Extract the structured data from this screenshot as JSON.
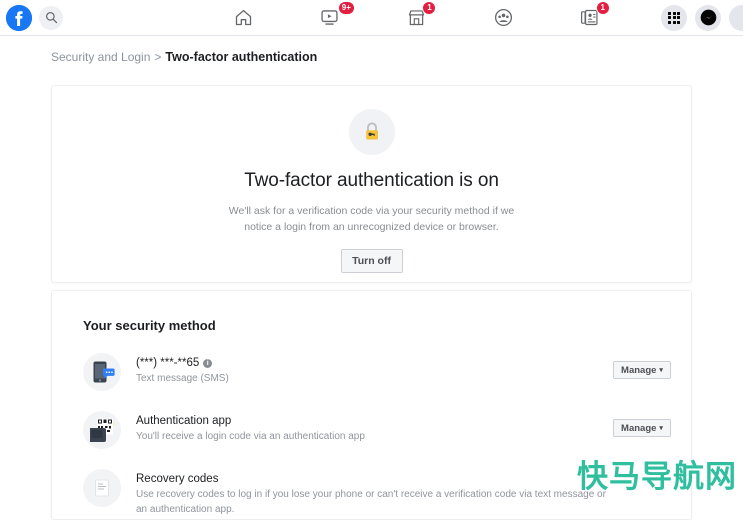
{
  "nav": {
    "logo_icon": "facebook-logo-icon",
    "search_icon": "search-icon",
    "tabs": [
      {
        "icon": "home-icon",
        "name": "home",
        "badge": ""
      },
      {
        "icon": "watch-video-icon",
        "name": "watch",
        "badge": "9+"
      },
      {
        "icon": "marketplace-storefront-icon",
        "name": "marketplace",
        "badge": "1"
      },
      {
        "icon": "groups-icon",
        "name": "groups",
        "badge": ""
      },
      {
        "icon": "news-feed-icon",
        "name": "news",
        "badge": "1"
      }
    ],
    "right": [
      {
        "icon": "menu-grid-icon",
        "name": "menu"
      },
      {
        "icon": "messenger-icon",
        "name": "messenger"
      },
      {
        "icon": "notifications-icon",
        "name": "notifications"
      }
    ]
  },
  "breadcrumb": {
    "parent": "Security and Login",
    "separator": ">",
    "current": "Two-factor authentication"
  },
  "status_card": {
    "icon": "padlock-icon",
    "title": "Two-factor authentication is on",
    "description": "We'll ask for a verification code via your security method if we notice a login from an unrecognized device or browser.",
    "button_label": "Turn off"
  },
  "methods_card": {
    "heading": "Your security method",
    "manage_label": "Manage",
    "caret": "▾",
    "info_glyph": "i",
    "items": [
      {
        "icon": "phone-sms-icon",
        "name": "(***) ***-**65",
        "has_info": true,
        "sub": "Text message (SMS)",
        "has_manage": true
      },
      {
        "icon": "qr-authenticator-icon",
        "name": "Authentication app",
        "has_info": false,
        "sub": "You'll receive a login code via an authentication app",
        "has_manage": true
      },
      {
        "icon": "recovery-document-icon",
        "name": "Recovery codes",
        "has_info": false,
        "sub": "Use recovery codes to log in if you lose your phone or can't receive a verification code via text message or an authentication app.",
        "has_manage": false
      }
    ]
  },
  "watermark": {
    "text": "快马导航网",
    "color": "#2fbf9e"
  },
  "colors": {
    "brand_blue": "#1877f2",
    "badge_red": "#e41e3f",
    "page_bg": "#ffffff",
    "card_border": "#eceef0",
    "text_primary": "#1c1e21",
    "text_secondary": "#8a8d91"
  }
}
